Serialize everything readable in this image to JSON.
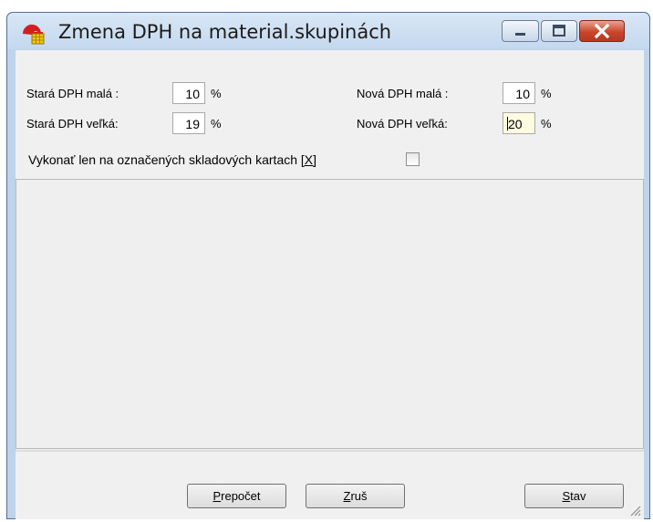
{
  "window": {
    "title": "Zmena DPH na material.skupinách",
    "controls": [
      "minimize-icon",
      "maximize-icon",
      "close-icon"
    ]
  },
  "form": {
    "old_small_label": "Stará DPH malá :",
    "old_small_value": "10",
    "old_big_label": "Stará DPH veľká:",
    "old_big_value": "19",
    "new_small_label": "Nová DPH malá :",
    "new_small_value": "10",
    "new_big_label": "Nová DPH veľká:",
    "new_big_value": "20",
    "percent": "%",
    "only_marked_label": "Vykonať len na označených skladových kartach",
    "only_marked_shortcut": "[X]",
    "only_marked_checked": false
  },
  "buttons": {
    "recalc_first": "P",
    "recalc_rest": "repočet",
    "cancel_first": "Z",
    "cancel_rest": "ruš",
    "status_first": "S",
    "status_rest": "tav"
  },
  "colors": {
    "title_bg": "#c4d8ee",
    "close_red": "#c9462c",
    "client_bg": "#f0f0f0",
    "active_field_bg": "#fffbe0"
  }
}
